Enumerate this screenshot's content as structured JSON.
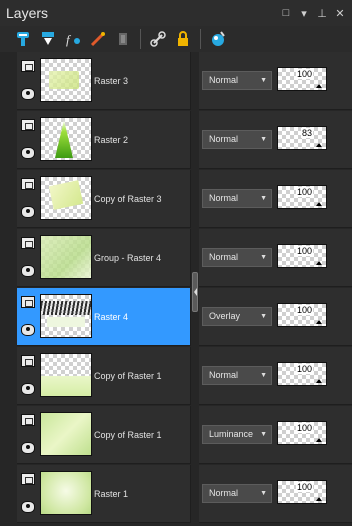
{
  "window": {
    "title": "Layers",
    "buttons": [
      "□",
      "▾",
      "⊥",
      "✕"
    ]
  },
  "toolbar": {
    "tools": [
      {
        "name": "new-raster-layer-icon",
        "color": "#27a9e1"
      },
      {
        "name": "new-vector-layer-icon",
        "color": "#27a9e1"
      },
      {
        "name": "effects-icon",
        "color": "#dddddd"
      },
      {
        "name": "mask-icon",
        "color": "#e05a2b"
      },
      {
        "name": "delete-layer-icon",
        "color": "#777777"
      },
      {
        "name": "link-icon",
        "color": "#dddddd"
      },
      {
        "name": "lock-icon",
        "color": "#f0b400"
      },
      {
        "name": "palette-icon",
        "color": "#27a9e1"
      }
    ]
  },
  "layers": [
    {
      "name": "Raster 3",
      "blend": "Normal",
      "opacity": "100",
      "selected": false
    },
    {
      "name": "Raster 2",
      "blend": "Normal",
      "opacity": "83",
      "selected": false
    },
    {
      "name": "Copy of Raster 3",
      "blend": "Normal",
      "opacity": "100",
      "selected": false
    },
    {
      "name": "Group - Raster 4",
      "blend": "Normal",
      "opacity": "100",
      "selected": false
    },
    {
      "name": "Raster 4",
      "blend": "Overlay",
      "opacity": "100",
      "selected": true
    },
    {
      "name": "Copy of Raster 1",
      "blend": "Normal",
      "opacity": "100",
      "selected": false
    },
    {
      "name": "Copy of Raster 1",
      "blend": "Luminance",
      "opacity": "100",
      "selected": false
    },
    {
      "name": "Raster 1",
      "blend": "Normal",
      "opacity": "100",
      "selected": false
    }
  ],
  "colors": {
    "selected": "#3399ff",
    "panel": "#2e2e2e"
  }
}
